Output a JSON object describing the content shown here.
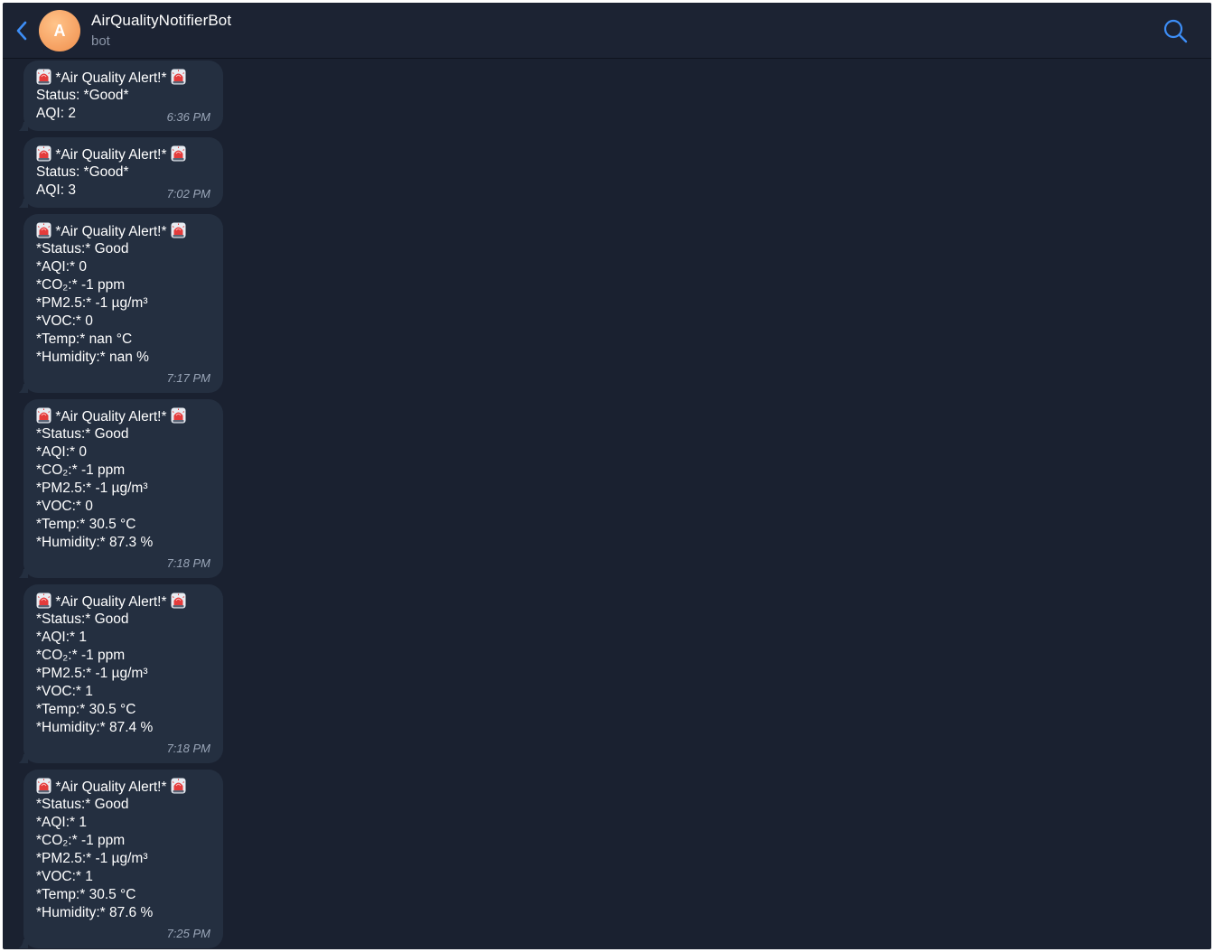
{
  "header": {
    "title": "AirQualityNotifierBot",
    "subtitle": "bot",
    "avatar_letter": "A",
    "back_icon": "chevron-left-icon",
    "search_icon": "search-icon"
  },
  "colors": {
    "background": "#1a2130",
    "bubble": "#242f40",
    "accent": "#3d8ef7",
    "avatar": "#f7a668"
  },
  "messages": [
    {
      "lines": [
        "*Air Quality Alert!*",
        "Status: *Good*",
        "AQI: 2"
      ],
      "time": "6:36 PM"
    },
    {
      "lines": [
        "*Air Quality Alert!*",
        "Status: *Good*",
        "AQI: 3"
      ],
      "time": "7:02 PM"
    },
    {
      "lines": [
        "*Air Quality Alert!*",
        "*Status:* Good",
        "*AQI:* 0",
        "*CO₂:* -1 ppm",
        "*PM2.5:* -1 µg/m³",
        "*VOC:* 0",
        "*Temp:* nan °C",
        "*Humidity:* nan %"
      ],
      "time": "7:17 PM"
    },
    {
      "lines": [
        "*Air Quality Alert!*",
        "*Status:* Good",
        "*AQI:* 0",
        "*CO₂:* -1 ppm",
        "*PM2.5:* -1 µg/m³",
        "*VOC:* 0",
        "*Temp:* 30.5 °C",
        "*Humidity:* 87.3 %"
      ],
      "time": "7:18 PM"
    },
    {
      "lines": [
        "*Air Quality Alert!*",
        "*Status:* Good",
        "*AQI:* 1",
        "*CO₂:* -1 ppm",
        "*PM2.5:* -1 µg/m³",
        "*VOC:* 1",
        "*Temp:* 30.5 °C",
        "*Humidity:* 87.4 %"
      ],
      "time": "7:18 PM"
    },
    {
      "lines": [
        "*Air Quality Alert!*",
        "*Status:* Good",
        "*AQI:* 1",
        "*CO₂:* -1 ppm",
        "*PM2.5:* -1 µg/m³",
        "*VOC:* 1",
        "*Temp:* 30.5 °C",
        "*Humidity:* 87.6 %"
      ],
      "time": "7:25 PM"
    }
  ],
  "alert_emoji": "rotating-light-icon"
}
